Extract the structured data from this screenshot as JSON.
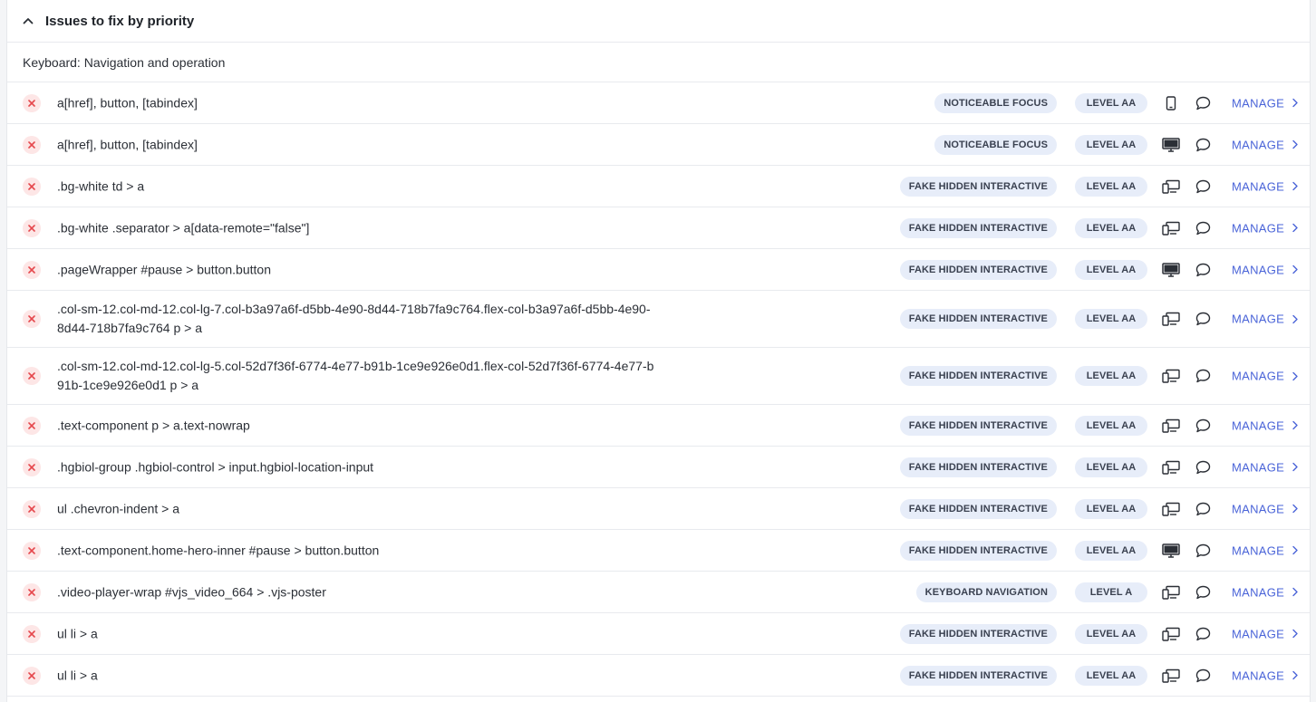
{
  "header": {
    "title": "Issues to fix by priority"
  },
  "category": "Keyboard: Navigation and operation",
  "manage_label": "MANAGE",
  "colors": {
    "accent": "#4a64d8",
    "error": "#e5484d",
    "tag_bg": "#e7edf9"
  },
  "issues": [
    {
      "selector": "a[href], button, [tabindex]",
      "type": "NOTICEABLE FOCUS",
      "level": "LEVEL AA",
      "device": "mobile-icon",
      "lines": 1
    },
    {
      "selector": "a[href], button, [tabindex]",
      "type": "NOTICEABLE FOCUS",
      "level": "LEVEL AA",
      "device": "desktop-icon",
      "lines": 1
    },
    {
      "selector": ".bg-white td > a",
      "type": "FAKE HIDDEN INTERACTIVE",
      "level": "LEVEL AA",
      "device": "multi-device-icon",
      "lines": 1
    },
    {
      "selector": ".bg-white .separator > a[data-remote=\"false\"]",
      "type": "FAKE HIDDEN INTERACTIVE",
      "level": "LEVEL AA",
      "device": "multi-device-icon",
      "lines": 1
    },
    {
      "selector": ".pageWrapper #pause > button.button",
      "type": "FAKE HIDDEN INTERACTIVE",
      "level": "LEVEL AA",
      "device": "desktop-icon",
      "lines": 1
    },
    {
      "selector": ".col-sm-12.col-md-12.col-lg-7.col-b3a97a6f-d5bb-4e90-8d44-718b7fa9c764.flex-col-b3a97a6f-d5bb-4e90-8d44-718b7fa9c764 p > a",
      "type": "FAKE HIDDEN INTERACTIVE",
      "level": "LEVEL AA",
      "device": "multi-device-icon",
      "lines": 2
    },
    {
      "selector": ".col-sm-12.col-md-12.col-lg-5.col-52d7f36f-6774-4e77-b91b-1ce9e926e0d1.flex-col-52d7f36f-6774-4e77-b91b-1ce9e926e0d1 p > a",
      "type": "FAKE HIDDEN INTERACTIVE",
      "level": "LEVEL AA",
      "device": "multi-device-icon",
      "lines": 2
    },
    {
      "selector": ".text-component p > a.text-nowrap",
      "type": "FAKE HIDDEN INTERACTIVE",
      "level": "LEVEL AA",
      "device": "multi-device-icon",
      "lines": 1
    },
    {
      "selector": ".hgbiol-group .hgbiol-control > input.hgbiol-location-input",
      "type": "FAKE HIDDEN INTERACTIVE",
      "level": "LEVEL AA",
      "device": "multi-device-icon",
      "lines": 1
    },
    {
      "selector": "ul .chevron-indent > a",
      "type": "FAKE HIDDEN INTERACTIVE",
      "level": "LEVEL AA",
      "device": "multi-device-icon",
      "lines": 1
    },
    {
      "selector": ".text-component.home-hero-inner #pause > button.button",
      "type": "FAKE HIDDEN INTERACTIVE",
      "level": "LEVEL AA",
      "device": "desktop-icon",
      "lines": 1
    },
    {
      "selector": ".video-player-wrap #vjs_video_664 > .vjs-poster",
      "type": "KEYBOARD NAVIGATION",
      "level": "LEVEL A",
      "device": "multi-device-icon",
      "lines": 1
    },
    {
      "selector": "ul li > a",
      "type": "FAKE HIDDEN INTERACTIVE",
      "level": "LEVEL AA",
      "device": "multi-device-icon",
      "lines": 1
    },
    {
      "selector": "ul li > a",
      "type": "FAKE HIDDEN INTERACTIVE",
      "level": "LEVEL AA",
      "device": "multi-device-icon",
      "lines": 1
    }
  ]
}
